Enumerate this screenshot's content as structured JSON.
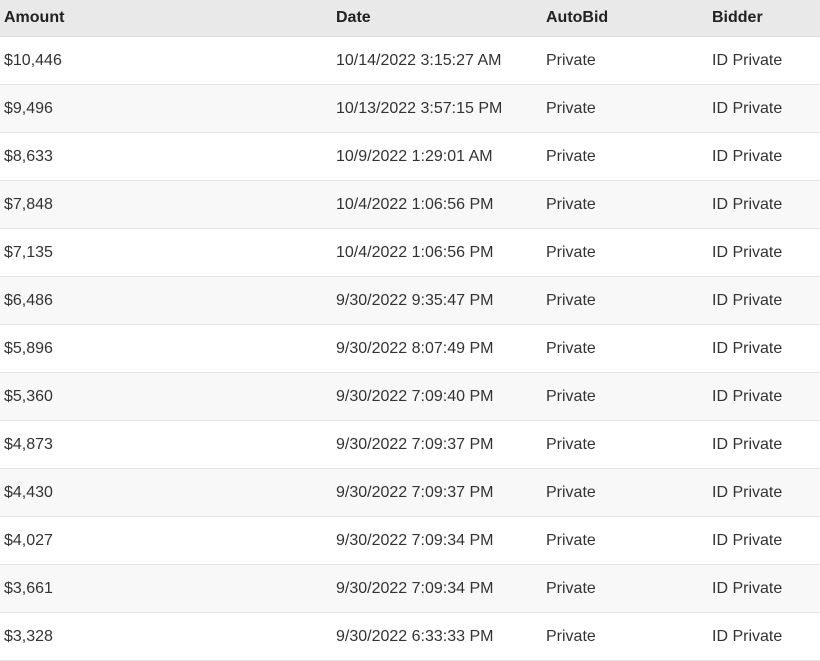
{
  "table": {
    "columns": [
      {
        "key": "amount",
        "label": "Amount",
        "name": "column-header-amount"
      },
      {
        "key": "date",
        "label": "Date",
        "name": "column-header-date"
      },
      {
        "key": "autobid",
        "label": "AutoBid",
        "name": "column-header-autobid"
      },
      {
        "key": "bidder",
        "label": "Bidder",
        "name": "column-header-bidder"
      }
    ],
    "rows": [
      {
        "amount": "$10,446",
        "date": "10/14/2022 3:15:27 AM",
        "autobid": "Private",
        "bidder": "ID Private"
      },
      {
        "amount": "$9,496",
        "date": "10/13/2022 3:57:15 PM",
        "autobid": "Private",
        "bidder": "ID Private"
      },
      {
        "amount": "$8,633",
        "date": "10/9/2022 1:29:01 AM",
        "autobid": "Private",
        "bidder": "ID Private"
      },
      {
        "amount": "$7,848",
        "date": "10/4/2022 1:06:56 PM",
        "autobid": "Private",
        "bidder": "ID Private"
      },
      {
        "amount": "$7,135",
        "date": "10/4/2022 1:06:56 PM",
        "autobid": "Private",
        "bidder": "ID Private"
      },
      {
        "amount": "$6,486",
        "date": "9/30/2022 9:35:47 PM",
        "autobid": "Private",
        "bidder": "ID Private"
      },
      {
        "amount": "$5,896",
        "date": "9/30/2022 8:07:49 PM",
        "autobid": "Private",
        "bidder": "ID Private"
      },
      {
        "amount": "$5,360",
        "date": "9/30/2022 7:09:40 PM",
        "autobid": "Private",
        "bidder": "ID Private"
      },
      {
        "amount": "$4,873",
        "date": "9/30/2022 7:09:37 PM",
        "autobid": "Private",
        "bidder": "ID Private"
      },
      {
        "amount": "$4,430",
        "date": "9/30/2022 7:09:37 PM",
        "autobid": "Private",
        "bidder": "ID Private"
      },
      {
        "amount": "$4,027",
        "date": "9/30/2022 7:09:34 PM",
        "autobid": "Private",
        "bidder": "ID Private"
      },
      {
        "amount": "$3,661",
        "date": "9/30/2022 7:09:34 PM",
        "autobid": "Private",
        "bidder": "ID Private"
      },
      {
        "amount": "$3,328",
        "date": "9/30/2022 6:33:33 PM",
        "autobid": "Private",
        "bidder": "ID Private"
      }
    ]
  },
  "theme": {
    "header_background": "#e9e9e9",
    "header_text": "#222222",
    "row_background": "#ffffff",
    "row_background_alt": "#f8f8f8",
    "row_border": "#e4e4e4",
    "cell_text": "#333333"
  }
}
